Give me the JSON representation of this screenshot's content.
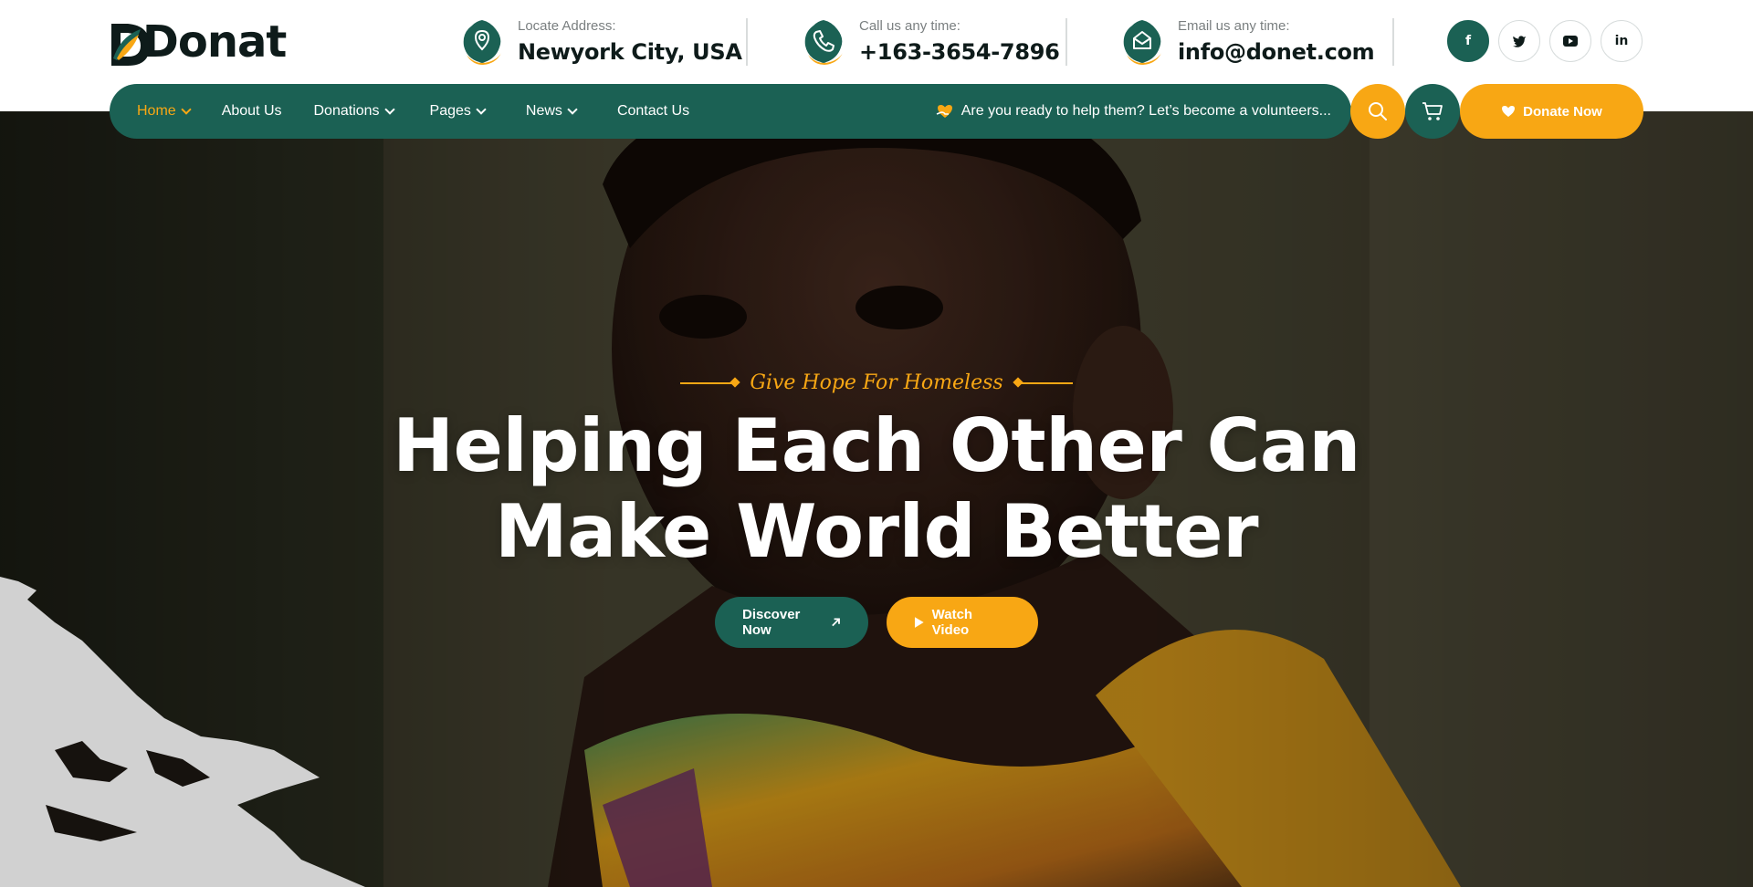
{
  "brand": {
    "logo_text": "Donat"
  },
  "contact": {
    "address_label": "Locate Address:",
    "address_value": "Newyork City, USA",
    "phone_label": "Call us any time:",
    "phone_value": "+163-3654-7896",
    "email_label": "Email us any time:",
    "email_value": "info@donet.com"
  },
  "socials": [
    {
      "icon": "facebook-icon",
      "glyph": "f"
    },
    {
      "icon": "twitter-icon",
      "glyph": "t"
    },
    {
      "icon": "youtube-icon",
      "glyph": "▶"
    },
    {
      "icon": "linkedin-icon",
      "glyph": "in"
    }
  ],
  "nav": {
    "items": [
      {
        "label": "Home",
        "dropdown": true,
        "active": true
      },
      {
        "label": "About Us",
        "dropdown": false
      },
      {
        "label": "Donations",
        "dropdown": true
      },
      {
        "label": "Pages",
        "dropdown": true
      },
      {
        "label": "News",
        "dropdown": true
      },
      {
        "label": "Contact Us",
        "dropdown": false
      }
    ],
    "cta_text": "Are you ready to help them? Let’s become a volunteers...",
    "donate_label": "Donate Now"
  },
  "hero": {
    "tagline": "Give Hope For Homeless",
    "headline_line1": "Helping Each Other Can",
    "headline_line2": "Make World Better",
    "discover_label": "Discover Now",
    "watch_label": "Watch Video"
  },
  "colors": {
    "primary": "#1b6154",
    "accent": "#f8a714",
    "dark": "#0e1b1a"
  }
}
